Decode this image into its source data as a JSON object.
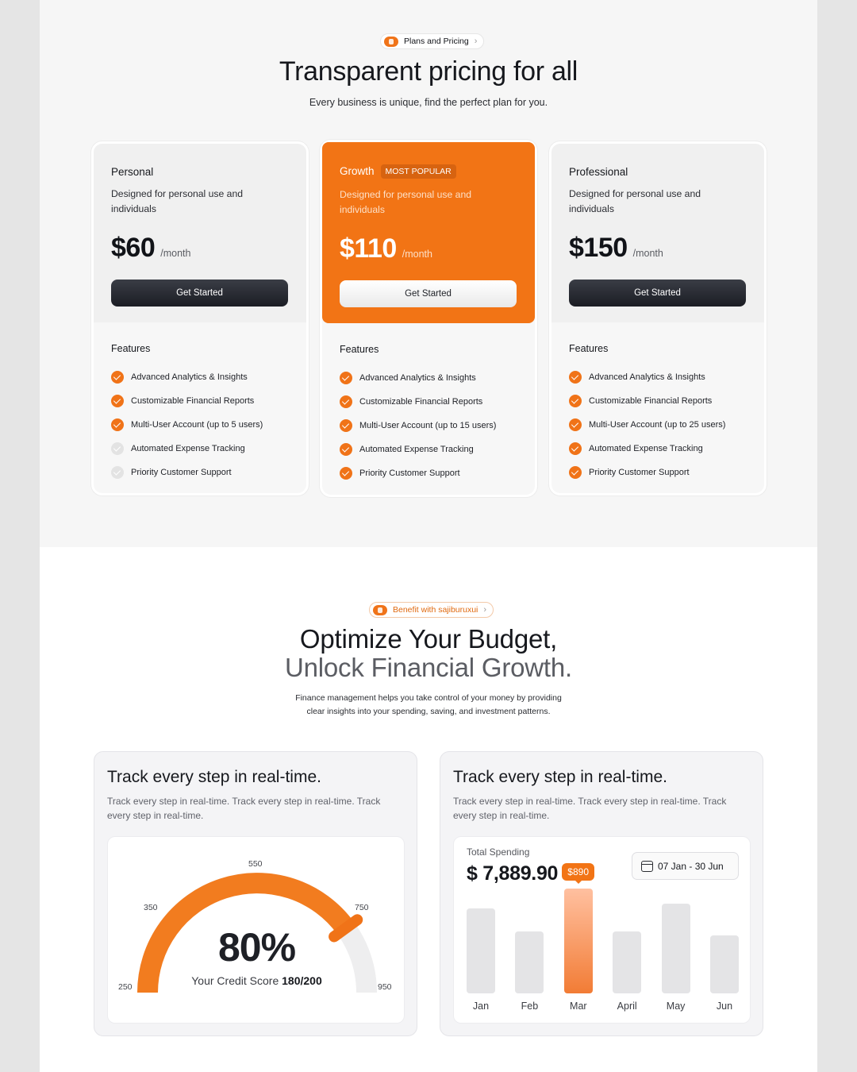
{
  "pricing": {
    "pill_label": "Plans and Pricing",
    "title": "Transparent pricing for all",
    "subtitle": "Every business is unique, find the perfect plan for you.",
    "accent_color": "#f27415",
    "plans": [
      {
        "name": "Personal",
        "badge": "",
        "description": "Designed for personal use and individuals",
        "price": "$60",
        "period": "/month",
        "cta": "Get Started",
        "features_title": "Features",
        "features": [
          {
            "label": "Advanced Analytics & Insights",
            "included": true
          },
          {
            "label": "Customizable Financial Reports",
            "included": true
          },
          {
            "label": "Multi-User Account (up to 5 users)",
            "included": true
          },
          {
            "label": "Automated Expense Tracking",
            "included": false
          },
          {
            "label": "Priority Customer Support",
            "included": false
          }
        ]
      },
      {
        "name": "Growth",
        "badge": "MOST POPULAR",
        "description": "Designed for personal use and individuals",
        "price": "$110",
        "period": "/month",
        "cta": "Get Started",
        "features_title": "Features",
        "features": [
          {
            "label": "Advanced Analytics & Insights",
            "included": true
          },
          {
            "label": "Customizable Financial Reports",
            "included": true
          },
          {
            "label": "Multi-User Account (up to 15 users)",
            "included": true
          },
          {
            "label": "Automated Expense Tracking",
            "included": true
          },
          {
            "label": "Priority Customer Support",
            "included": true
          }
        ]
      },
      {
        "name": "Professional",
        "badge": "",
        "description": "Designed for personal use and individuals",
        "price": "$150",
        "period": "/month",
        "cta": "Get Started",
        "features_title": "Features",
        "features": [
          {
            "label": "Advanced Analytics & Insights",
            "included": true
          },
          {
            "label": "Customizable Financial Reports",
            "included": true
          },
          {
            "label": "Multi-User Account (up to 25 users)",
            "included": true
          },
          {
            "label": "Automated Expense Tracking",
            "included": true
          },
          {
            "label": "Priority Customer Support",
            "included": true
          }
        ]
      }
    ]
  },
  "benefit": {
    "pill_label": "Benefit with sajiburuxui",
    "title_line1": "Optimize Your Budget,",
    "title_line2": "Unlock Financial Growth.",
    "description_line1": "Finance management helps you take control of your money by providing",
    "description_line2": "clear insights into your spending, saving, and investment patterns.",
    "cards": [
      {
        "title": "Track every step in real-time.",
        "text": "Track every step in real-time. Track every step in real-time. Track every step in real-time."
      },
      {
        "title": "Track every step in real-time.",
        "text": "Track every step in real-time. Track every step in real-time. Track every step in real-time."
      }
    ]
  },
  "gauge": {
    "percent_label": "80%",
    "caption": "Your Credit Score",
    "score": "180/200",
    "fill_fraction": 0.8,
    "scale_labels": [
      "250",
      "350",
      "550",
      "750",
      "950"
    ]
  },
  "spending": {
    "label": "Total Spending",
    "total": "$ 7,889.90",
    "date_range": "07 Jan - 30 Jun"
  },
  "chart_data": {
    "type": "bar",
    "title": "Total Spending",
    "categories": [
      "Jan",
      "Feb",
      "Mar",
      "April",
      "May",
      "Jun"
    ],
    "values": [
      640,
      470,
      790,
      470,
      680,
      440
    ],
    "highlight_index": 2,
    "highlight_label": "$890",
    "ylim": [
      0,
      900
    ],
    "grid": false
  }
}
